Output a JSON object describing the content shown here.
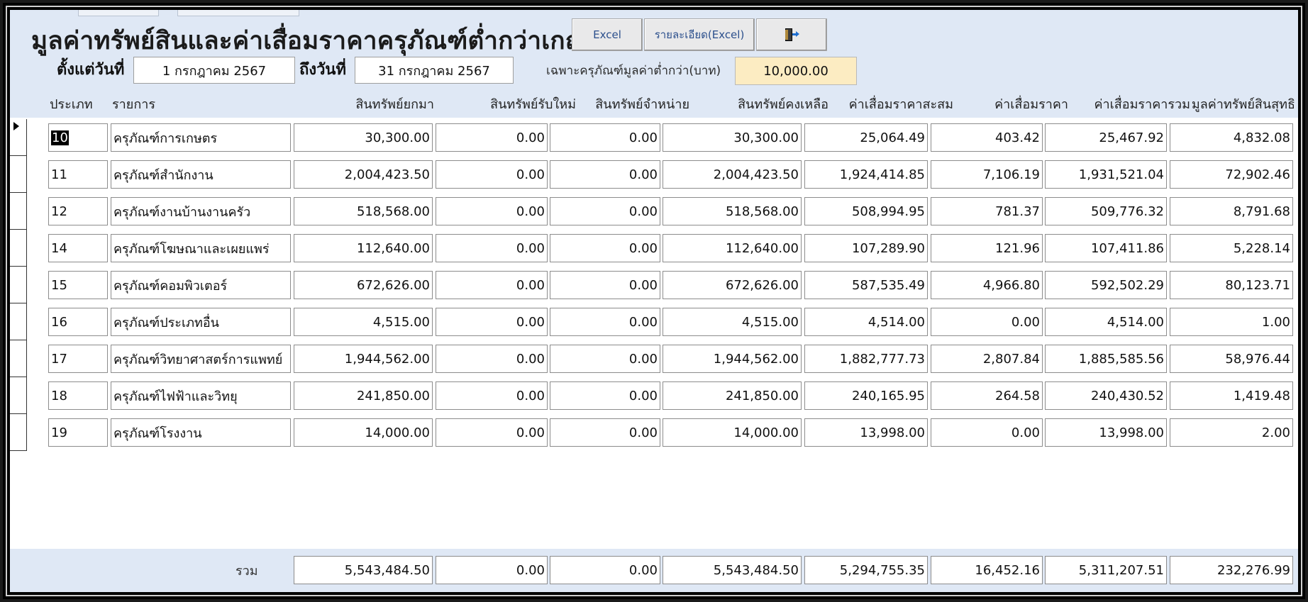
{
  "header": {
    "title": "มูลค่าทรัพย์สินและค่าเสื่อมราคาครุภัณฑ์ต่ำกว่าเกณฑ์",
    "buttons": {
      "excel": "Excel",
      "detail_excel": "รายละเอียด(Excel)",
      "exit_icon": "exit-door-icon"
    }
  },
  "filters": {
    "from_label": "ตั้งแต่วันที่",
    "from_value": "1 กรกฎาคม 2567",
    "to_label": "ถึงวันที่",
    "to_value": "31 กรกฎาคม 2567",
    "limit_label": "เฉพาะครุภัณฑ์มูลค่าต่ำกว่า(บาท)",
    "limit_value": "10,000.00"
  },
  "columns": [
    "ประเภท",
    "รายการ",
    "สินทรัพย์ยกมา",
    "สินทรัพย์รับใหม่",
    "สินทรัพย์จำหน่าย",
    "สินทรัพย์คงเหลือ",
    "ค่าเสื่อมราคาสะสม",
    "ค่าเสื่อมราคา",
    "ค่าเสื่อมราคารวม",
    "มูลค่าทรัพย์สินสุทธิ"
  ],
  "rows": [
    {
      "code": "10",
      "name": "ครุภัณฑ์การเกษตร",
      "brought": "30,300.00",
      "received": "0.00",
      "disposed": "0.00",
      "remaining": "30,300.00",
      "accum_dep": "25,064.49",
      "dep": "403.42",
      "total_dep": "25,467.92",
      "net": "4,832.08"
    },
    {
      "code": "11",
      "name": "ครุภัณฑ์สำนักงาน",
      "brought": "2,004,423.50",
      "received": "0.00",
      "disposed": "0.00",
      "remaining": "2,004,423.50",
      "accum_dep": "1,924,414.85",
      "dep": "7,106.19",
      "total_dep": "1,931,521.04",
      "net": "72,902.46"
    },
    {
      "code": "12",
      "name": "ครุภัณฑ์งานบ้านงานครัว",
      "brought": "518,568.00",
      "received": "0.00",
      "disposed": "0.00",
      "remaining": "518,568.00",
      "accum_dep": "508,994.95",
      "dep": "781.37",
      "total_dep": "509,776.32",
      "net": "8,791.68"
    },
    {
      "code": "14",
      "name": "ครุภัณฑ์โฆษณาและเผยแพร่",
      "brought": "112,640.00",
      "received": "0.00",
      "disposed": "0.00",
      "remaining": "112,640.00",
      "accum_dep": "107,289.90",
      "dep": "121.96",
      "total_dep": "107,411.86",
      "net": "5,228.14"
    },
    {
      "code": "15",
      "name": "ครุภัณฑ์คอมพิวเตอร์",
      "brought": "672,626.00",
      "received": "0.00",
      "disposed": "0.00",
      "remaining": "672,626.00",
      "accum_dep": "587,535.49",
      "dep": "4,966.80",
      "total_dep": "592,502.29",
      "net": "80,123.71"
    },
    {
      "code": "16",
      "name": "ครุภัณฑ์ประเภทอื่น",
      "brought": "4,515.00",
      "received": "0.00",
      "disposed": "0.00",
      "remaining": "4,515.00",
      "accum_dep": "4,514.00",
      "dep": "0.00",
      "total_dep": "4,514.00",
      "net": "1.00"
    },
    {
      "code": "17",
      "name": "ครุภัณฑ์วิทยาศาสตร์การแพทย์",
      "brought": "1,944,562.00",
      "received": "0.00",
      "disposed": "0.00",
      "remaining": "1,944,562.00",
      "accum_dep": "1,882,777.73",
      "dep": "2,807.84",
      "total_dep": "1,885,585.56",
      "net": "58,976.44"
    },
    {
      "code": "18",
      "name": "ครุภัณฑ์ไฟฟ้าและวิทยุ",
      "brought": "241,850.00",
      "received": "0.00",
      "disposed": "0.00",
      "remaining": "241,850.00",
      "accum_dep": "240,165.95",
      "dep": "264.58",
      "total_dep": "240,430.52",
      "net": "1,419.48"
    },
    {
      "code": "19",
      "name": "ครุภัณฑ์โรงงาน",
      "brought": "14,000.00",
      "received": "0.00",
      "disposed": "0.00",
      "remaining": "14,000.00",
      "accum_dep": "13,998.00",
      "dep": "0.00",
      "total_dep": "13,998.00",
      "net": "2.00"
    }
  ],
  "totals": {
    "label": "รวม",
    "brought": "5,543,484.50",
    "received": "0.00",
    "disposed": "0.00",
    "remaining": "5,543,484.50",
    "accum_dep": "5,294,755.35",
    "dep": "16,452.16",
    "total_dep": "5,311,207.51",
    "net": "232,276.99"
  }
}
